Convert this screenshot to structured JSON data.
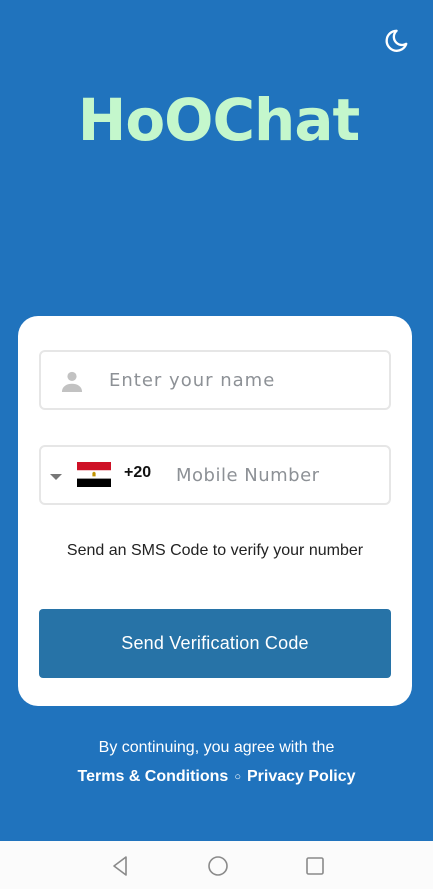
{
  "app": {
    "title": "HoOChat"
  },
  "header": {
    "theme_toggle_icon": "moon-icon"
  },
  "login": {
    "name_placeholder": "Enter your name",
    "name_icon": "person-icon",
    "country_flag": "egypt-flag",
    "dial_code": "+20",
    "phone_placeholder": "Mobile Number",
    "sms_note": "Send an SMS Code to verify your number",
    "send_button_label": "Send Verification Code"
  },
  "legal": {
    "intro": "By continuing, you agree with the",
    "terms_label": "Terms & Conditions",
    "separator": "○",
    "privacy_label": "Privacy Policy"
  },
  "nav": {
    "back_icon": "triangle-back-icon",
    "home_icon": "circle-home-icon",
    "recent_icon": "square-recent-icon"
  },
  "colors": {
    "background": "#2073bd",
    "brand_text": "#c4f7cc",
    "button": "#2773a7",
    "card": "#ffffff"
  }
}
